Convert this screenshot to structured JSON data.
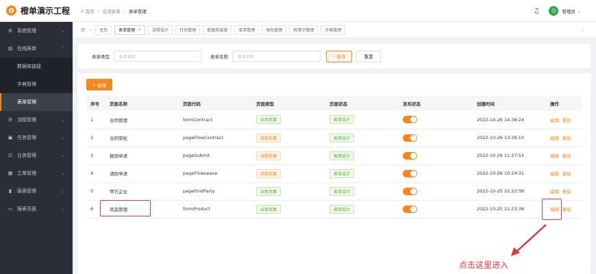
{
  "app": {
    "title": "橙单演示工程"
  },
  "breadcrumb": {
    "home": "首页",
    "level1": "在线表单",
    "current": "表单管理"
  },
  "user": {
    "name": "管理员"
  },
  "sidebar": {
    "items": [
      {
        "label": "系统管理",
        "icon": "gear-icon",
        "glyph": "⚙"
      },
      {
        "label": "在线表单",
        "icon": "form-icon",
        "glyph": "▤"
      }
    ],
    "subitems": [
      {
        "label": "数据库链接"
      },
      {
        "label": "字典管理"
      },
      {
        "label": "表单管理"
      }
    ],
    "items2": [
      {
        "label": "流程管理",
        "icon": "flow-icon",
        "glyph": "☰"
      },
      {
        "label": "任务管理",
        "icon": "task-icon",
        "glyph": "▣"
      },
      {
        "label": "业务管理",
        "icon": "lock-icon",
        "glyph": "⊡"
      },
      {
        "label": "工单管理",
        "icon": "grid-icon",
        "glyph": "▦"
      },
      {
        "label": "报表管理",
        "icon": "bar-chart-icon",
        "glyph": "▮"
      },
      {
        "label": "报表页面",
        "icon": "folder-icon",
        "glyph": "▭"
      }
    ]
  },
  "tags": [
    "主页",
    "表单管理",
    "流程设计",
    "打印管理",
    "数据库链接",
    "菜单管理",
    "角色管理",
    "权限字管理",
    "字典管理"
  ],
  "search": {
    "type_label": "表单类型",
    "type_placeholder": "表单类型",
    "name_label": "表单名称",
    "name_placeholder": "表单名称",
    "query_btn": "查询",
    "reset_btn": "重置"
  },
  "table": {
    "add_btn": "新增",
    "headers": [
      "序号",
      "页面名称",
      "页面代码",
      "页面类型",
      "页面状态",
      "发布状态",
      "创建时间",
      "操作"
    ],
    "rows": [
      {
        "no": "1",
        "name": "合同管理",
        "code": "formContract",
        "type": "业务页面",
        "type_color": "green",
        "status": "表单设计",
        "time": "2022-10-26 14:36:24",
        "published": true
      },
      {
        "no": "2",
        "name": "合同审批",
        "code": "pageFlowContract",
        "type": "流程页面",
        "type_color": "orange",
        "status": "表单设计",
        "time": "2022-10-26 13:39:10",
        "published": true
      },
      {
        "no": "3",
        "name": "报销申请",
        "code": "pageSubmit",
        "type": "流程页面",
        "type_color": "orange",
        "status": "表单设计",
        "time": "2022-10-26 11:37:53",
        "published": true
      },
      {
        "no": "4",
        "name": "请假申请",
        "code": "pageFlowLeave",
        "type": "流程页面",
        "type_color": "orange",
        "status": "表单设计",
        "time": "2022-10-26 10:24:31",
        "published": true
      },
      {
        "no": "5",
        "name": "甲方企业",
        "code": "pageFirstParty",
        "type": "业务页面",
        "type_color": "green",
        "status": "表单设计",
        "time": "2022-10-25 22:22:38",
        "published": true
      },
      {
        "no": "6",
        "name": "商品管理",
        "code": "formProduct",
        "type": "业务页面",
        "type_color": "green",
        "status": "表单设计",
        "time": "2022-10-25 21:23:38",
        "published": true
      }
    ],
    "edit_label": "编辑",
    "delete_label": "删除"
  },
  "annotation": {
    "text": "点击这里进入"
  },
  "colors": {
    "accent": "#f5871f",
    "sidebar": "#2b2f3a",
    "annotation": "#d9363e"
  }
}
